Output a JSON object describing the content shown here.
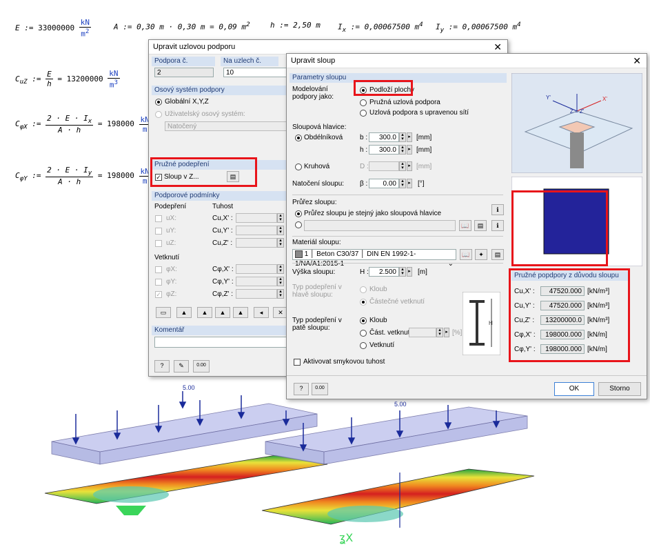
{
  "formulas": {
    "E": {
      "lhs": "E",
      "assign": ":=",
      "value": "33000000",
      "unit_num": "kN",
      "unit_den": "m",
      "unit_den_exp": "2"
    },
    "A": {
      "text": "A := 0,30 m · 0,30 m = 0,09 m",
      "exp": "2"
    },
    "h": {
      "text": "h := 2,50 m"
    },
    "Ix": {
      "text": "I",
      "sub": "x",
      "rest": ":= 0,00067500 m",
      "exp": "4"
    },
    "Iy": {
      "text": "I",
      "sub": "y",
      "rest": ":= 0,00067500 m",
      "exp": "4"
    },
    "CuZ": {
      "lhs": "C",
      "sub": "uZ",
      "num": "E",
      "den": "h",
      "result": "= 13200000",
      "unit_num": "kN",
      "unit_den": "m",
      "unit_exp": "3"
    },
    "CphiX": {
      "lhs": "C",
      "sub": "φX",
      "num": "2 · E · I",
      "num_sub": "x",
      "den": "A · h",
      "result": "= 198000",
      "unit_num": "kN",
      "unit_den": "m"
    },
    "CphiY": {
      "lhs": "C",
      "sub": "φY",
      "num": "2 · E · I",
      "num_sub": "y",
      "den": "A · h",
      "result": "= 198000",
      "unit_num": "kN",
      "unit_den": "m"
    }
  },
  "dlg1": {
    "title": "Upravit uzlovou podporu",
    "support_no_label": "Podpora č.",
    "support_no": "2",
    "nodes_label": "Na uzlech č.",
    "nodes": "10",
    "axis_group": "Osový systém podpory",
    "global_xyz": "Globální X,Y,Z",
    "user_axis": "Uživatelský osový systém:",
    "rotated": "Natočený",
    "elastic_group": "Pružné podepření",
    "column_in_z": "Sloup v Z...",
    "conditions_group": "Podporové podmínky",
    "support_col": "Podepření",
    "stiffness_col": "Tuhost",
    "ux": "uX:",
    "uy": "uY:",
    "uz": "uZ:",
    "cux": "Cu,X' :",
    "cuy": "Cu,Y' :",
    "cuz": "Cu,Z' :",
    "restraint": "Vetknutí",
    "phix": "φX:",
    "phiy": "φY:",
    "phiz": "φZ:",
    "cphix": "Cφ,X' :",
    "cphiy": "Cφ,Y' :",
    "cphiz": "Cφ,Z' :",
    "comment_group": "Komentář",
    "calc_label": "0.00"
  },
  "dlg2": {
    "title": "Upravit sloup",
    "params_group": "Parametry sloupu",
    "model_label": "Modelování podpory jako:",
    "opt_surface": "Podloží plochy",
    "opt_elastic": "Pružná uzlová podpora",
    "opt_mesh": "Uzlová podpora s upravenou sítí",
    "head_label": "Sloupová hlavice:",
    "rect": "Obdélníková",
    "b": "b :",
    "b_val": "300.0",
    "h": "h :",
    "h_val": "300.0",
    "mm": "[mm]",
    "circ": "Kruhová",
    "D": "D :",
    "rot_label": "Natočení sloupu:",
    "beta": "β :",
    "beta_val": "0.00",
    "deg": "[°]",
    "section_label": "Průřez sloupu:",
    "section_same": "Průřez sloupu je stejný jako sloupová hlavice",
    "material_label": "Materiál sloupu:",
    "material_no": "1",
    "material": "Beton C30/37",
    "material_norm": "DIN EN 1992-1-1/NA/A1:2015-1",
    "height_label": "Výška sloupu:",
    "H": "H :",
    "H_val": "2.500",
    "m": "[m]",
    "head_type": "Typ podepření v hlavě sloupu:",
    "hinge": "Kloub",
    "partial": "Částečné vetknutí",
    "foot_type": "Typ podepření v patě sloupu:",
    "foot_hinge": "Kloub",
    "foot_partial": "Část. vetknutí",
    "pct": "[%]",
    "foot_fixed": "Vetknutí",
    "shear": "Aktivovat smykovou tuhost",
    "springs_group": "Pružné popdpory z důvodu sloupu",
    "springs": [
      {
        "label": "Cu,X' :",
        "value": "47520.000",
        "unit": "[kN/m³]"
      },
      {
        "label": "Cu,Y' :",
        "value": "47520.000",
        "unit": "[kN/m³]"
      },
      {
        "label": "Cu,Z' :",
        "value": "13200000.0",
        "unit": "[kN/m³]"
      },
      {
        "label": "Cφ,X' :",
        "value": "198000.000",
        "unit": "[kN/m]"
      },
      {
        "label": "Cφ,Y' :",
        "value": "198000.000",
        "unit": "[kN/m]"
      }
    ],
    "ok": "OK",
    "cancel": "Storno",
    "calc_label": "0.00",
    "axis_x": "X'",
    "axis_y": "Y'",
    "axis_z": "Z = Z'"
  },
  "model": {
    "load_left": "5.00",
    "load_right": "5.00"
  },
  "colors": {
    "accent_red": "#e8141a",
    "group_bg": "#d6e2f2",
    "plate": "#b8bce8",
    "section_fill": "#23239a"
  }
}
